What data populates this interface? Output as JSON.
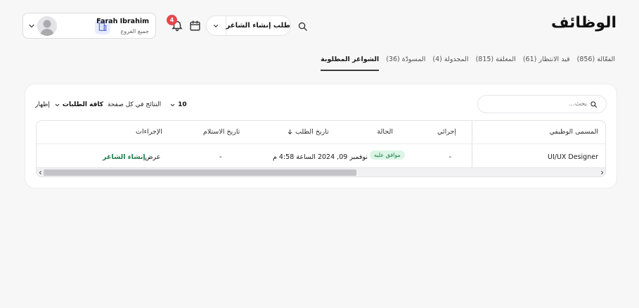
{
  "header": {
    "title": "الوظائف",
    "create_label": "طلب إنشاء الشاغر",
    "notification_count": "4"
  },
  "user": {
    "name": "Farah Ibrahim",
    "branch": "جميع الفروع"
  },
  "tabs": [
    {
      "label": "الفعّالة (856)",
      "active": false
    },
    {
      "label": "قيد الانتظار (61)",
      "active": false
    },
    {
      "label": "المغلقة (815)",
      "active": false
    },
    {
      "label": "المجدولة (4)",
      "active": false
    },
    {
      "label": "المسودّة (36)",
      "active": false
    },
    {
      "label": "الشواغر المطلوبة",
      "active": true
    }
  ],
  "toolbar": {
    "search_placeholder": "بحث...",
    "show_label": "إظهار",
    "filter_value": "كافة الطلبات",
    "per_page_label": "النتائج في كل صفحة",
    "per_page_value": "10"
  },
  "table": {
    "columns": {
      "job_title": "المسمى الوظيفي",
      "procedure": "إجرائي",
      "status": "الحالة",
      "request_date": "تاريخ الطلب",
      "receive_date": "تاريخ الاستلام",
      "actions": "الإجراءات"
    },
    "rows": [
      {
        "job_title": "UI/UX Designer",
        "procedure": "-",
        "status": "موافق عليه",
        "request_date": "نوفمبر 09, 2024 الساعة 4:58 م",
        "receive_date": "-",
        "action_view": "عرض",
        "action_create": "إنشاء الشاغر"
      }
    ]
  },
  "colors": {
    "accent_green": "#1f7a49",
    "badge_bg": "#dcf5e6",
    "notification_red": "#e5484d"
  }
}
